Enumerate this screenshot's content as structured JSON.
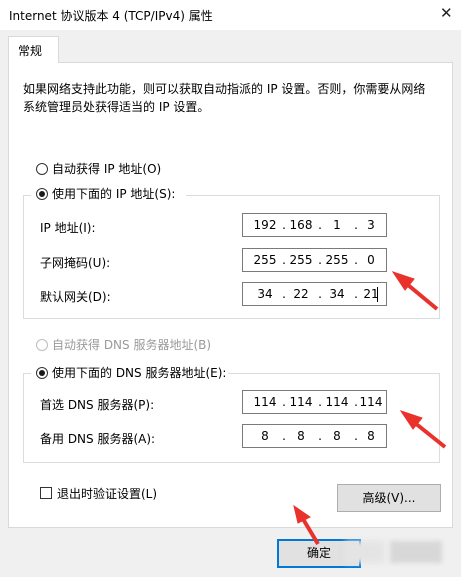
{
  "window": {
    "title": "Internet 协议版本 4 (TCP/IPv4) 属性",
    "close_glyph": "✕"
  },
  "tabs": [
    {
      "label": "常规"
    }
  ],
  "description": "如果网络支持此功能，则可以获取自动指派的 IP 设置。否则，你需要从网络系统管理员处获得适当的 IP 设置。",
  "ip_mode": {
    "auto_label": "自动获得 IP 地址(O)",
    "manual_label": "使用下面的 IP 地址(S):",
    "selected": "manual"
  },
  "ip_fields": {
    "ip_label": "IP 地址(I):",
    "ip": [
      "192",
      "168",
      "1",
      "3"
    ],
    "mask_label": "子网掩码(U):",
    "mask": [
      "255",
      "255",
      "255",
      "0"
    ],
    "gateway_label": "默认网关(D):",
    "gateway": [
      "34",
      "22",
      "34",
      "21"
    ]
  },
  "dns_mode": {
    "auto_label": "自动获得 DNS 服务器地址(B)",
    "manual_label": "使用下面的 DNS 服务器地址(E):",
    "selected": "manual",
    "auto_disabled": true
  },
  "dns_fields": {
    "preferred_label": "首选 DNS 服务器(P):",
    "preferred": [
      "114",
      "114",
      "114",
      "114"
    ],
    "alternate_label": "备用 DNS 服务器(A):",
    "alternate": [
      "8",
      "8",
      "8",
      "8"
    ]
  },
  "validate_on_exit": {
    "label": "退出时验证设置(L)",
    "checked": false
  },
  "buttons": {
    "advanced": "高级(V)...",
    "ok": "确定"
  },
  "colors": {
    "annotation_arrow": "#e8322b",
    "focus_border": "#0078d7"
  }
}
